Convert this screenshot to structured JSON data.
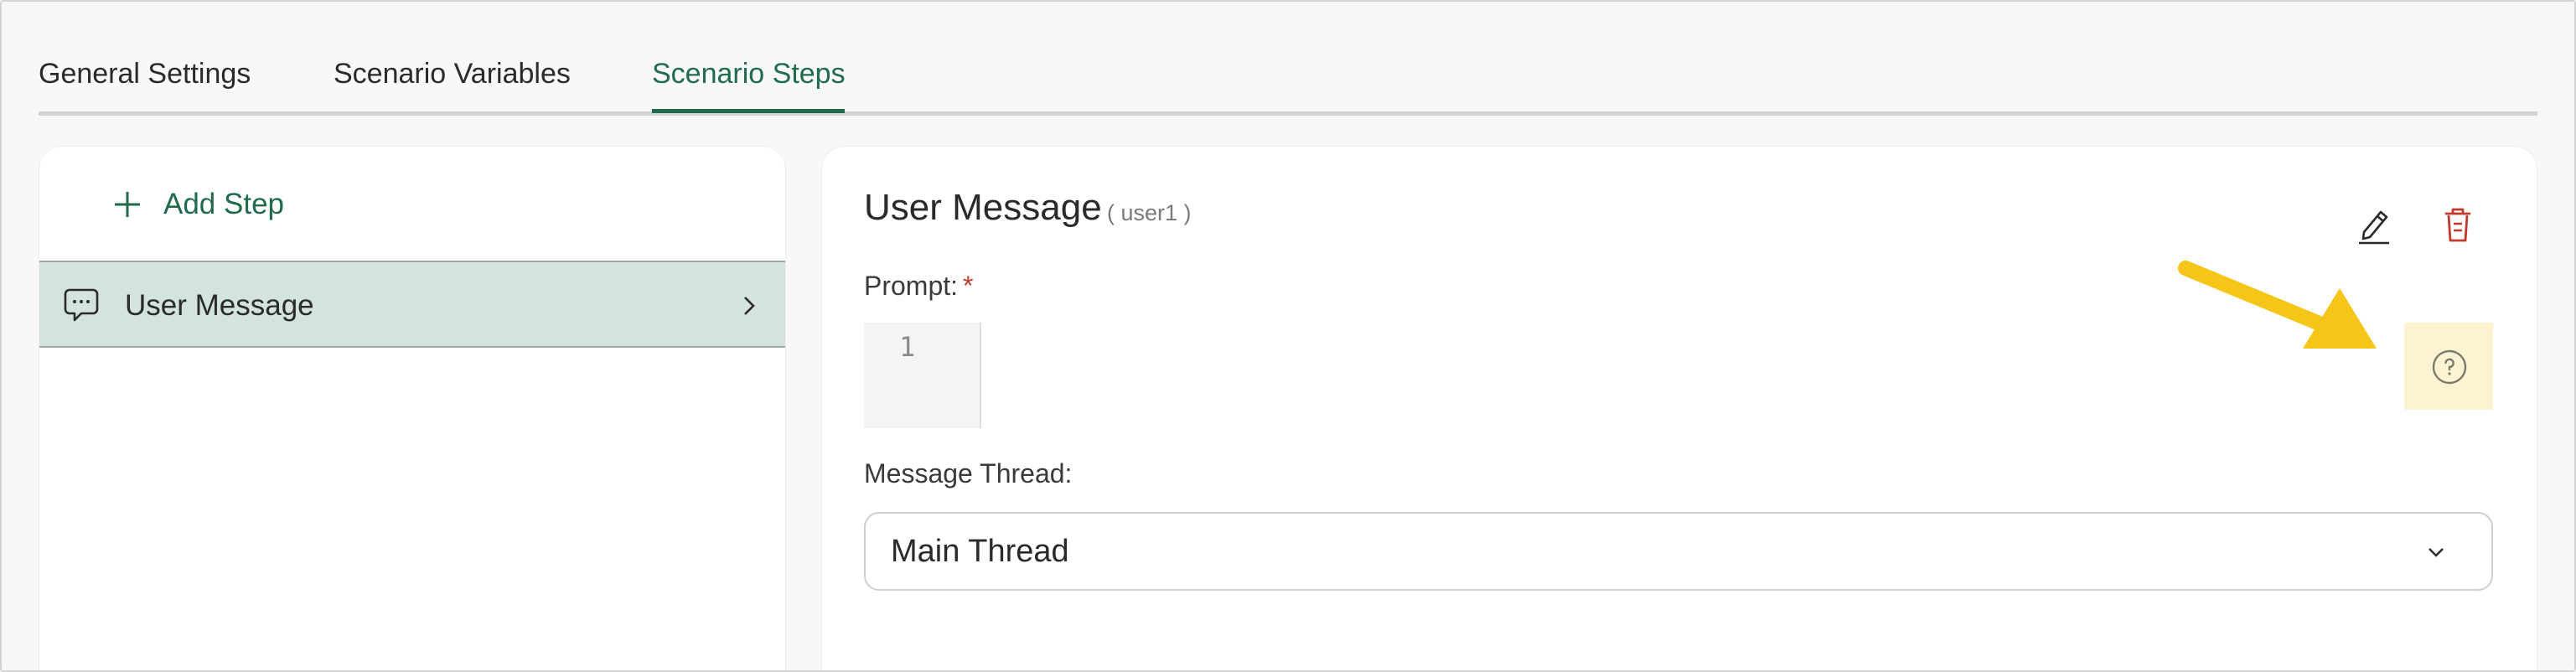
{
  "tabs": [
    {
      "label": "General Settings"
    },
    {
      "label": "Scenario Variables"
    },
    {
      "label": "Scenario Steps"
    }
  ],
  "active_tab": "Scenario Steps",
  "sidebar": {
    "add_step_label": "Add Step",
    "steps": [
      {
        "label": "User Message",
        "icon": "chat-bubble-icon",
        "selected": true
      }
    ]
  },
  "detail": {
    "title": "User Message",
    "step_id": "( user1 )",
    "prompt_label": "Prompt:",
    "required_mark": "*",
    "editor_line_number": "1",
    "message_thread_label": "Message Thread:",
    "message_thread_value": "Main Thread"
  },
  "colors": {
    "accent": "#1f6b4c",
    "selected_row": "#d2e4dc",
    "delete": "#c0392b",
    "help_highlight": "#fdf3d2",
    "annotation_arrow": "#f5c518"
  }
}
